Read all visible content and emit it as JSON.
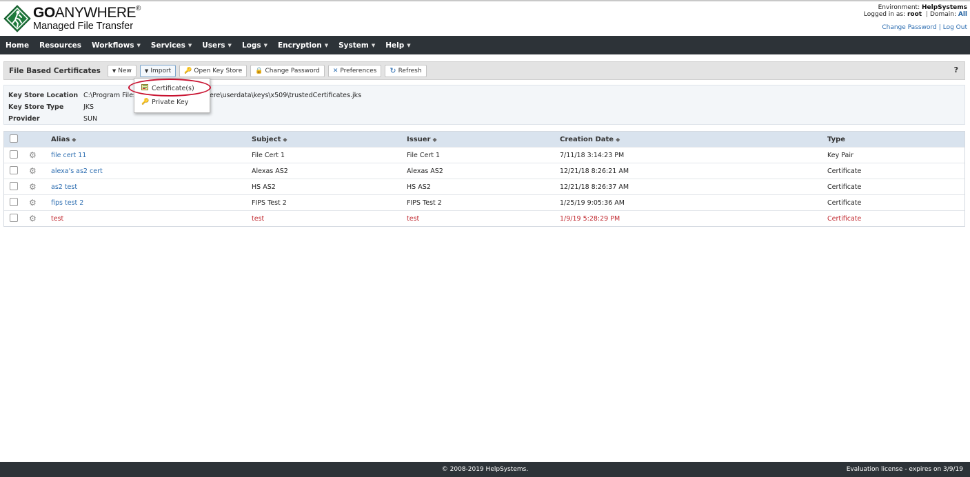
{
  "header": {
    "logo_line1_bold": "GO",
    "logo_line1": "ANYWHERE",
    "logo_reg": "®",
    "logo_line2": "Managed File Transfer",
    "env_label": "Environment:",
    "env_value": "HelpSystems",
    "logged_label": "Logged in as:",
    "logged_user": "root",
    "domain_label": "Domain:",
    "domain_value": "All",
    "change_password_link": "Change Password",
    "logout_link": "Log Out"
  },
  "nav": [
    {
      "label": "Home",
      "dropdown": false
    },
    {
      "label": "Resources",
      "dropdown": false
    },
    {
      "label": "Workflows",
      "dropdown": true
    },
    {
      "label": "Services",
      "dropdown": true
    },
    {
      "label": "Users",
      "dropdown": true
    },
    {
      "label": "Logs",
      "dropdown": true
    },
    {
      "label": "Encryption",
      "dropdown": true
    },
    {
      "label": "System",
      "dropdown": true
    },
    {
      "label": "Help",
      "dropdown": true
    }
  ],
  "toolbar": {
    "title": "File Based Certificates",
    "new_label": "New",
    "import_label": "Import",
    "open_key_store_label": "Open Key Store",
    "change_password_label": "Change Password",
    "preferences_label": "Preferences",
    "refresh_label": "Refresh",
    "help_label": "?"
  },
  "import_menu": {
    "certificates": "Certificate(s)",
    "private_key": "Private Key"
  },
  "keystore": {
    "location_label": "Key Store Location",
    "location_value_a": "C:\\Program Files",
    "location_value_b": "ere\\userdata\\keys\\x509\\trustedCertificates.jks",
    "type_label": "Key Store Type",
    "type_value": "JKS",
    "provider_label": "Provider",
    "provider_value": "SUN"
  },
  "table": {
    "columns": {
      "alias": "Alias",
      "subject": "Subject",
      "issuer": "Issuer",
      "date": "Creation Date",
      "type": "Type"
    },
    "rows": [
      {
        "alias": "file cert 11",
        "subject": "File Cert 1",
        "issuer": "File Cert 1",
        "date": "7/11/18 3:14:23 PM",
        "type": "Key Pair",
        "error": false
      },
      {
        "alias": "alexa's as2 cert",
        "subject": "Alexas AS2",
        "issuer": "Alexas AS2",
        "date": "12/21/18 8:26:21 AM",
        "type": "Certificate",
        "error": false
      },
      {
        "alias": "as2 test",
        "subject": "HS AS2",
        "issuer": "HS AS2",
        "date": "12/21/18 8:26:37 AM",
        "type": "Certificate",
        "error": false
      },
      {
        "alias": "fips test 2",
        "subject": "FIPS Test 2",
        "issuer": "FIPS Test 2",
        "date": "1/25/19 9:05:36 AM",
        "type": "Certificate",
        "error": false
      },
      {
        "alias": "test",
        "subject": "test",
        "issuer": "test",
        "date": "1/9/19 5:28:29 PM",
        "type": "Certificate",
        "error": true
      }
    ]
  },
  "footer": {
    "copyright": "© 2008-2019 HelpSystems.",
    "license": "Evaluation license - expires on 3/9/19"
  },
  "colors": {
    "navbar_bg": "#2d3338",
    "link": "#2b6cb0",
    "error": "#c0262d",
    "logo_green": "#1e7a3c",
    "highlight": "#c8102e"
  }
}
